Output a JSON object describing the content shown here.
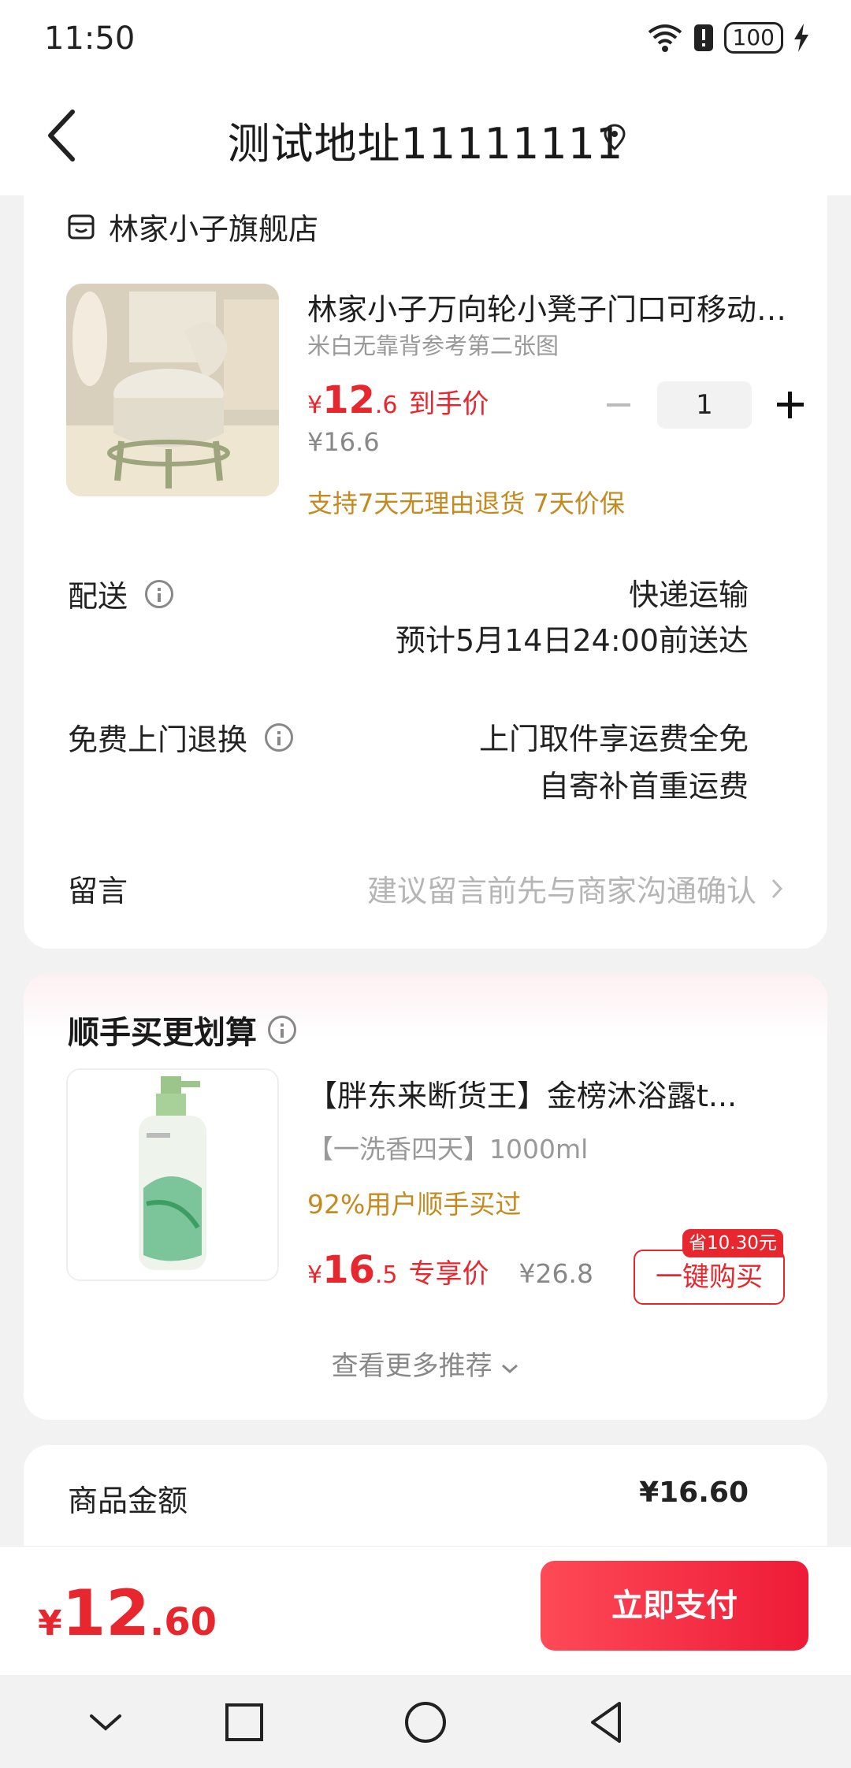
{
  "status_bar": {
    "time": "11:50",
    "battery": "100"
  },
  "header": {
    "title": "测试地址11111111"
  },
  "order": {
    "shop_name": "林家小子旗舰店",
    "product": {
      "title": "林家小子万向轮小凳子门口可移动换鞋凳",
      "sku": "米白无靠背参考第二张图",
      "price_symbol": "¥",
      "price_int": "12",
      "price_dec": ".6",
      "price_tag": "到手价",
      "original_price": "¥16.6",
      "quantity": "1",
      "guarantee": "支持7天无理由退货  7天价保"
    },
    "delivery": {
      "label": "配送",
      "line1": "快递运输",
      "line2": "预计5月14日24:00前送达"
    },
    "free_return": {
      "label": "免费上门退换",
      "line1": "上门取件享运费全免",
      "line2": "自寄补首重运费"
    },
    "remark": {
      "label": "留言",
      "placeholder": "建议留言前先与商家沟通确认"
    }
  },
  "recommendation": {
    "title": "顺手买更划算",
    "product": {
      "name": "【胖东来断货王】金榜沐浴露t...",
      "desc": "【一洗香四天】1000ml",
      "social": "92%用户顺手买过",
      "price_symbol": "¥",
      "price_int": "16",
      "price_dec": ".5",
      "price_tag": "专享价",
      "original_price": "¥26.8",
      "save_badge": "省10.30元",
      "buy_label": "一键购买"
    },
    "more_label": "查看更多推荐"
  },
  "summary": {
    "goods_amount_label": "商品金额",
    "goods_amount_value": "¥16.60"
  },
  "bottom": {
    "total_symbol": "¥",
    "total_int": "12",
    "total_dec": ".60",
    "pay_label": "立即支付"
  },
  "colors": {
    "accent": "#e8262d",
    "gold": "#c48a1e",
    "background": "#f2f2f2"
  }
}
